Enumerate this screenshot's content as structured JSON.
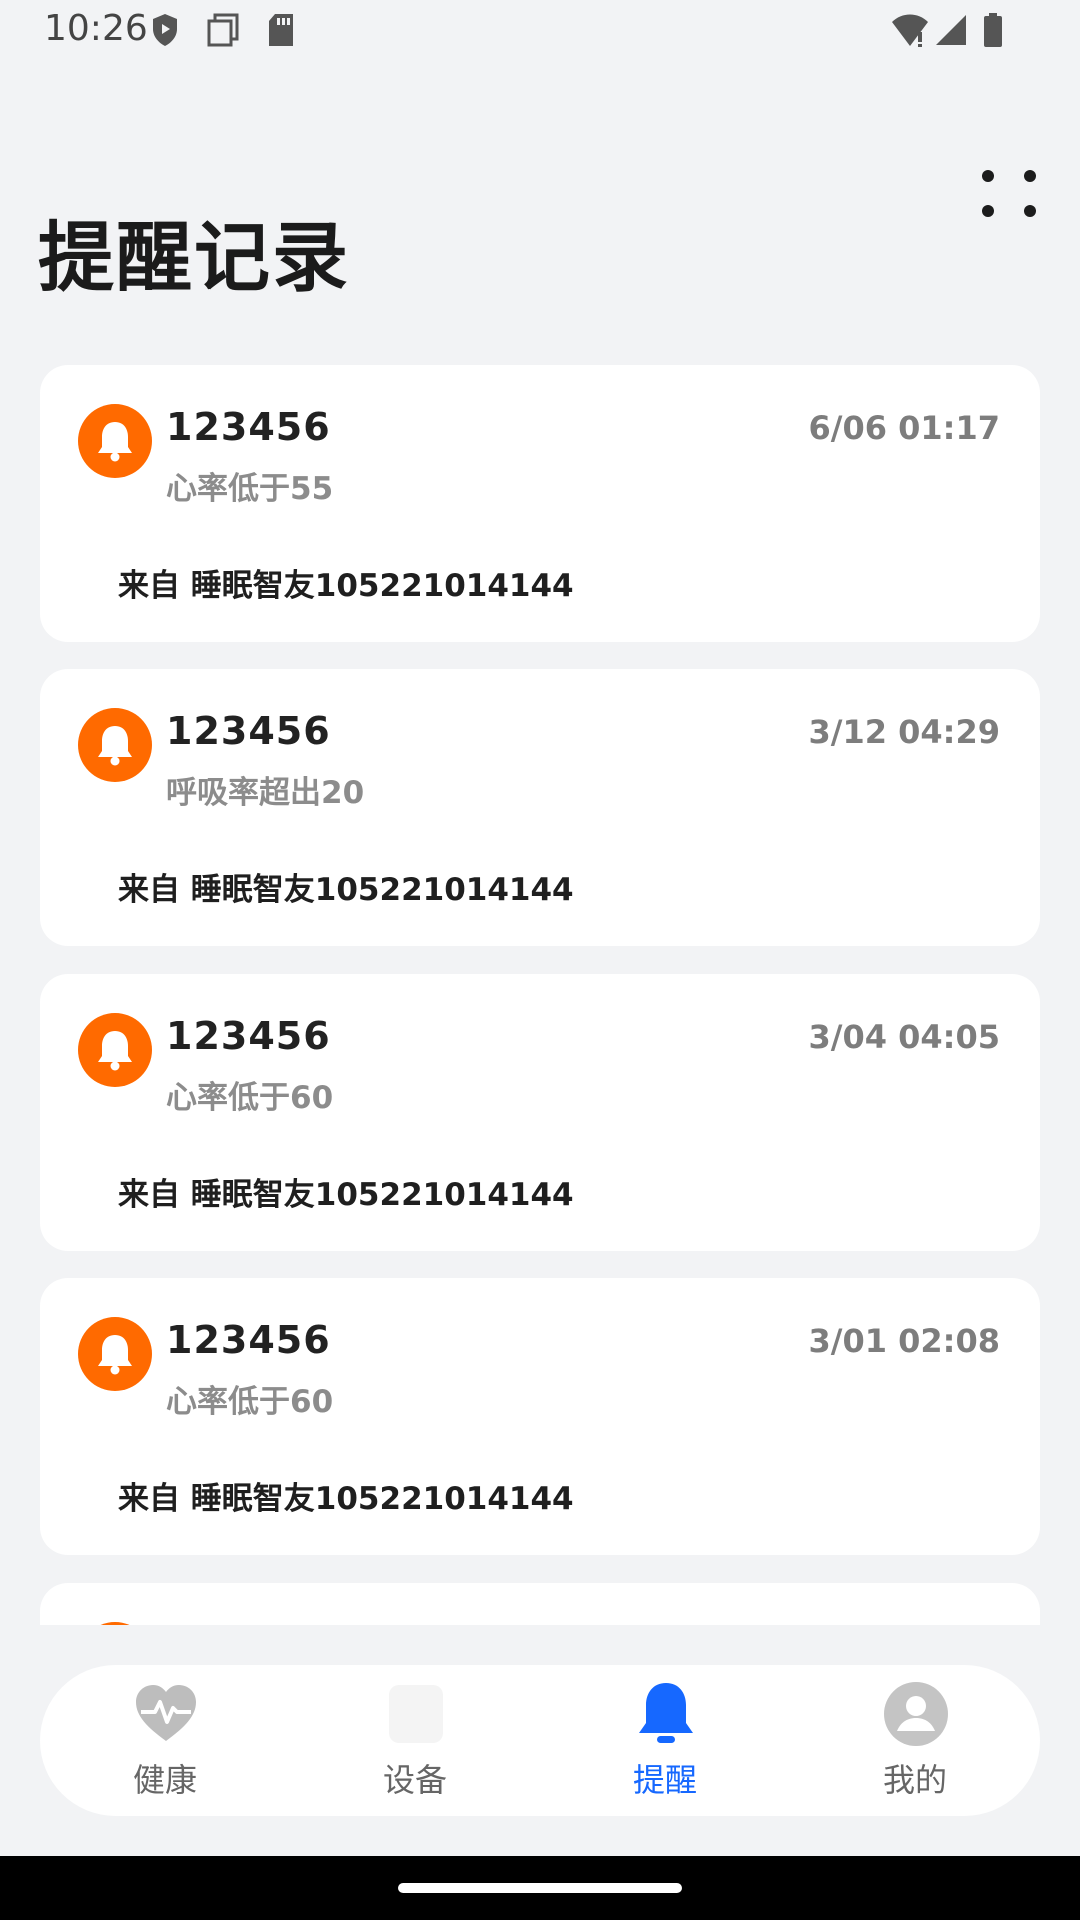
{
  "status_bar": {
    "time": "10:26"
  },
  "header": {
    "title": "提醒记录"
  },
  "reminders": [
    {
      "name": "123456",
      "time": "6/06 01:17",
      "alert": "心率低于55",
      "source": "来自 睡眠智友105221014144"
    },
    {
      "name": "123456",
      "time": "3/12 04:29",
      "alert": "呼吸率超出20",
      "source": "来自 睡眠智友105221014144"
    },
    {
      "name": "123456",
      "time": "3/04 04:05",
      "alert": "心率低于60",
      "source": "来自 睡眠智友105221014144"
    },
    {
      "name": "123456",
      "time": "3/01 02:08",
      "alert": "心率低于60",
      "source": "来自 睡眠智友105221014144"
    }
  ],
  "bottom_nav": [
    {
      "label": "健康",
      "icon": "heart-pulse-icon"
    },
    {
      "label": "设备",
      "icon": "device-icon"
    },
    {
      "label": "提醒",
      "icon": "bell-icon",
      "active": true
    },
    {
      "label": "我的",
      "icon": "profile-icon"
    }
  ],
  "colors": {
    "accent": "#1668ff",
    "badge": "#ff6a00",
    "background": "#f2f3f5"
  }
}
